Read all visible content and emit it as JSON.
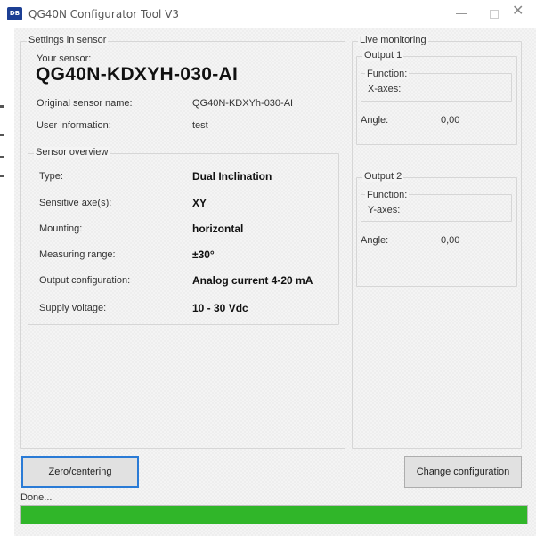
{
  "window": {
    "logo_text": "DB",
    "title": "QG40N Configurator Tool V3",
    "minimize": "—",
    "close": "✕"
  },
  "settings": {
    "group_title": "Settings in sensor",
    "your_sensor_label": "Your sensor:",
    "your_sensor_value": "QG40N-KDXYH-030-AI",
    "original_name_label": "Original sensor name:",
    "original_name_value": "QG40N-KDXYh-030-AI",
    "user_info_label": "User information:",
    "user_info_value": "test"
  },
  "overview": {
    "group_title": "Sensor overview",
    "rows": [
      {
        "label": "Type:",
        "value": "Dual Inclination"
      },
      {
        "label": "Sensitive axe(s):",
        "value": "XY"
      },
      {
        "label": "Mounting:",
        "value": "horizontal"
      },
      {
        "label": "Measuring range:",
        "value": "±30°"
      },
      {
        "label": "Output configuration:",
        "value": "Analog current 4-20 mA"
      },
      {
        "label": "Supply voltage:",
        "value": "10 - 30 Vdc"
      }
    ]
  },
  "live": {
    "group_title": "Live monitoring",
    "output1": {
      "title": "Output 1",
      "function_label": "Function:",
      "function_value": "X-axes:",
      "angle_label": "Angle:",
      "angle_value": "0,00"
    },
    "output2": {
      "title": "Output 2",
      "function_label": "Function:",
      "function_value": "Y-axes:",
      "angle_label": "Angle:",
      "angle_value": "0,00"
    }
  },
  "buttons": {
    "zero": "Zero/centering",
    "change": "Change configuration"
  },
  "status": {
    "text": "Done...",
    "progress": 1.0,
    "progress_color": "#30b629"
  },
  "colors": {
    "logo_bg": "#1c3f94",
    "focus_border": "#2a7bd6"
  }
}
